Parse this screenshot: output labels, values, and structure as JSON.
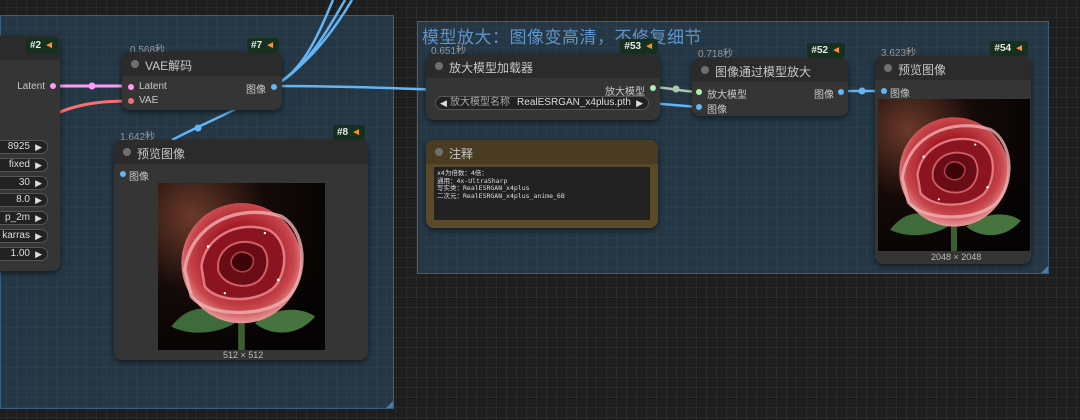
{
  "groups": {
    "right_title": "模型放大：图像变高清，不修复细节"
  },
  "colors": {
    "latent_wire": "#ff9cf9",
    "vae_wire": "#ff6e6e",
    "image_wire": "#64b5f6",
    "upscale_model_wire": "#b0c4b1",
    "badge_bg": "#163020",
    "note_bg": "#5a4a2a"
  },
  "nodes": {
    "ksampler": {
      "badge": "#2",
      "output_label": "Latent",
      "widgets": [
        "8925",
        "fixed",
        "30",
        "8.0",
        "p_2m",
        "karras",
        "1.00"
      ]
    },
    "vae_decode": {
      "exec_time": "0.568秒",
      "badge": "#7",
      "title": "VAE解码",
      "inputs": [
        "Latent",
        "VAE"
      ],
      "output_label": "图像"
    },
    "preview_8": {
      "exec_time": "1.642秒",
      "badge": "#8",
      "title": "预览图像",
      "input_label": "图像",
      "image_icon": "red-rose-image",
      "image_size": "512 × 512"
    },
    "upscale_loader": {
      "exec_time": "0.651秒",
      "badge": "#53",
      "title": "放大模型加载器",
      "output_label": "放大模型",
      "widget_name": "放大模型名称",
      "widget_value": "RealESRGAN_x4plus.pth"
    },
    "note": {
      "title": "注释",
      "text": "x4为倍数：4倍：\n通用：4x-UltraSharp\n写实类：RealESRGAN_x4plus\n二次元：RealESRGAN_x4plus_anime_6B"
    },
    "upscale_image": {
      "exec_time": "0.718秒",
      "badge": "#52",
      "title": "图像通过模型放大",
      "inputs": [
        "放大模型",
        "图像"
      ],
      "output_label": "图像"
    },
    "preview_54": {
      "exec_time": "3.623秒",
      "badge": "#54",
      "title": "预览图像",
      "input_label": "图像",
      "image_icon": "red-rose-image",
      "image_size": "2048 × 2048"
    }
  }
}
